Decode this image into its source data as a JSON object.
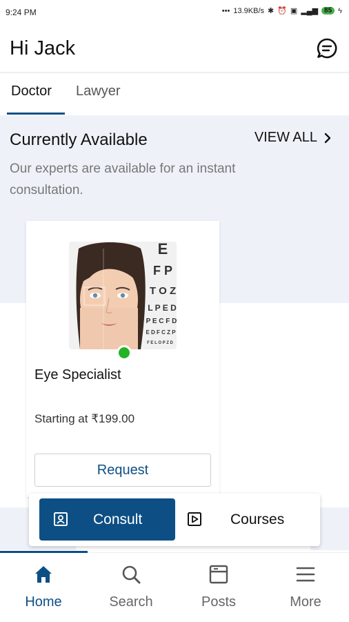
{
  "status_bar": {
    "time": "9:24 PM",
    "net_speed": "13.9KB/s",
    "battery": "85"
  },
  "header": {
    "greeting": "Hi Jack"
  },
  "tabs": [
    {
      "label": "Doctor",
      "selected": true
    },
    {
      "label": "Lawyer",
      "selected": false
    }
  ],
  "section": {
    "title": "Currently Available",
    "view_all": "VIEW ALL",
    "subtitle": "Our experts are available for an instant consultation."
  },
  "card": {
    "specialty": "Eye Specialist",
    "price": "Starting at  ₹199.00",
    "request_label": "Request",
    "online": true,
    "eye_chart_letters": [
      "E",
      "F P",
      "T O Z",
      "L P E D",
      "P E C F D",
      "E D F C Z P",
      "F E L O P Z D"
    ]
  },
  "switcher": {
    "consult_label": "Consult",
    "courses_label": "Courses"
  },
  "nav": [
    {
      "label": "Home",
      "icon": "home-icon",
      "active": true
    },
    {
      "label": "Search",
      "icon": "search-icon",
      "active": false
    },
    {
      "label": "Posts",
      "icon": "posts-icon",
      "active": false
    },
    {
      "label": "More",
      "icon": "menu-icon",
      "active": false
    }
  ],
  "colors": {
    "primary": "#0d4f85",
    "online": "#24b327",
    "hero_bg": "#eef2f8"
  }
}
